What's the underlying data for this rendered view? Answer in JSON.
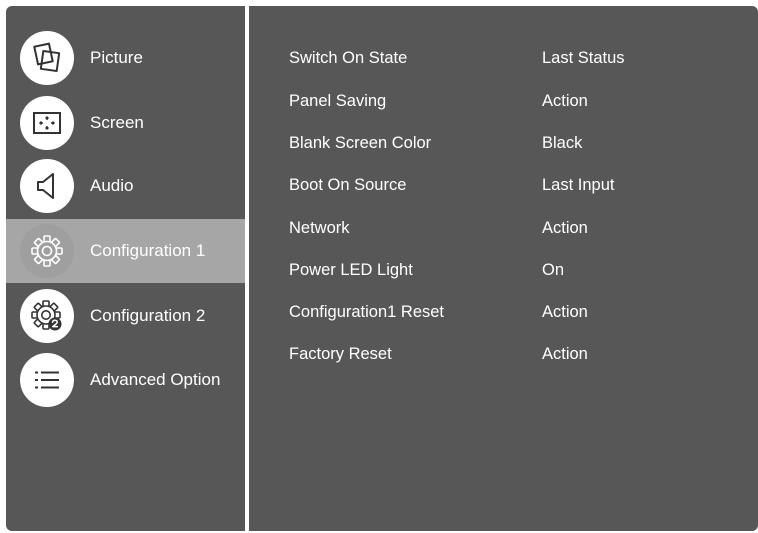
{
  "sidebar": {
    "items": [
      {
        "label": "Picture",
        "icon": "picture-icon",
        "active": false
      },
      {
        "label": "Screen",
        "icon": "screen-icon",
        "active": false
      },
      {
        "label": "Audio",
        "icon": "speaker-icon",
        "active": false
      },
      {
        "label": "Configuration 1",
        "icon": "gear-icon",
        "active": true
      },
      {
        "label": "Configuration 2",
        "icon": "gear-2-icon",
        "active": false
      },
      {
        "label": "Advanced Option",
        "icon": "list-icon",
        "active": false
      }
    ]
  },
  "settings": {
    "rows": [
      {
        "label": "Switch On State",
        "value": "Last Status"
      },
      {
        "label": "Panel Saving",
        "value": "Action"
      },
      {
        "label": "Blank Screen Color",
        "value": "Black"
      },
      {
        "label": "Boot On Source",
        "value": "Last Input"
      },
      {
        "label": "Network",
        "value": "Action"
      },
      {
        "label": "Power LED Light",
        "value": "On"
      },
      {
        "label": "Configuration1 Reset",
        "value": "Action"
      },
      {
        "label": "Factory Reset",
        "value": "Action"
      }
    ]
  },
  "colors": {
    "panel_bg": "#575757",
    "active_bg": "#a6a6a6",
    "icon_circle": "#ffffff",
    "text": "#ffffff"
  }
}
